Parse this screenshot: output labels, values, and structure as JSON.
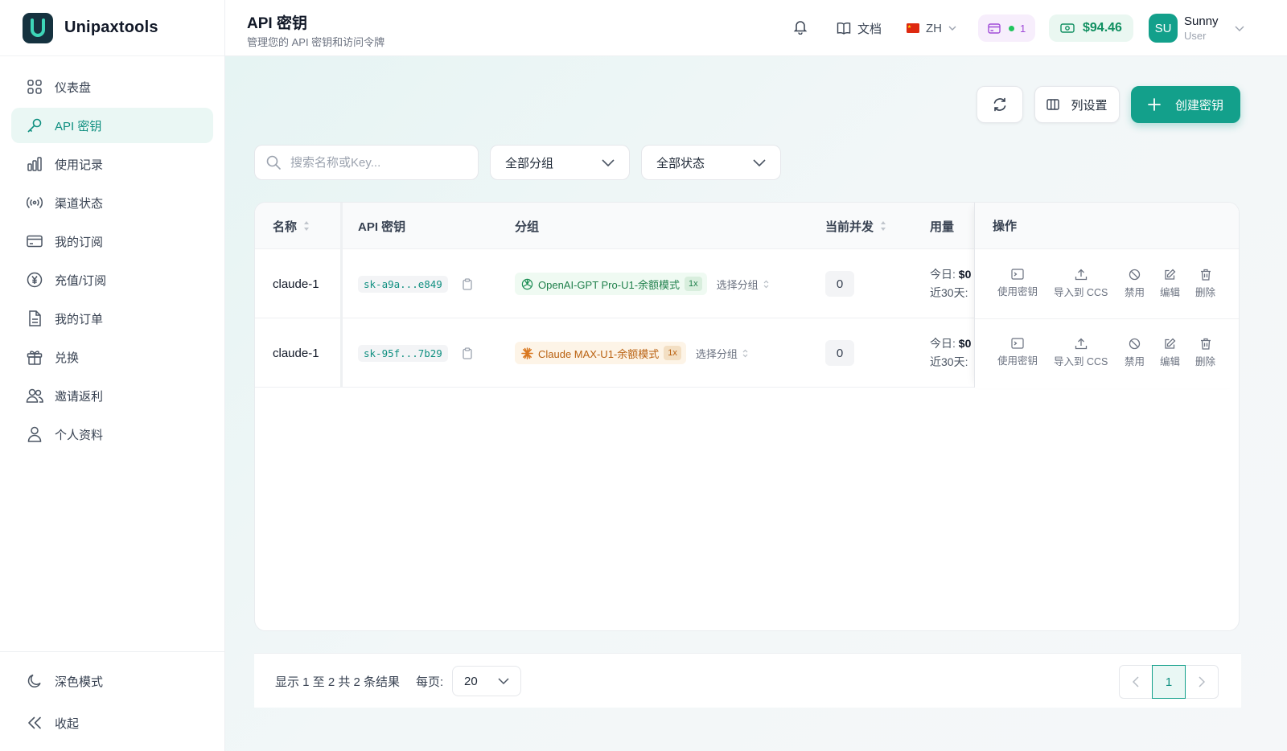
{
  "brand": {
    "name": "Unipaxtools",
    "logo_letter": "U"
  },
  "sidebar": {
    "items": [
      {
        "label": "仪表盘",
        "icon": "grid-icon",
        "active": false
      },
      {
        "label": "API 密钥",
        "icon": "key-icon",
        "active": true
      },
      {
        "label": "使用记录",
        "icon": "bar-chart-icon",
        "active": false
      },
      {
        "label": "渠道状态",
        "icon": "broadcast-icon",
        "active": false
      },
      {
        "label": "我的订阅",
        "icon": "credit-card-icon",
        "active": false
      },
      {
        "label": "充值/订阅",
        "icon": "yen-circle-icon",
        "active": false
      },
      {
        "label": "我的订单",
        "icon": "document-icon",
        "active": false
      },
      {
        "label": "兑换",
        "icon": "gift-icon",
        "active": false
      },
      {
        "label": "邀请返利",
        "icon": "users-icon",
        "active": false
      },
      {
        "label": "个人资料",
        "icon": "user-icon",
        "active": false
      }
    ],
    "dark_mode_label": "深色模式",
    "collapse_label": "收起"
  },
  "header": {
    "title": "API 密钥",
    "subtitle": "管理您的 API 密钥和访问令牌",
    "docs_label": "文档",
    "lang_label": "ZH",
    "subscription_count": "1",
    "balance": "$94.46",
    "user": {
      "initials": "SU",
      "name": "Sunny",
      "role": "User"
    }
  },
  "toolbar": {
    "columns_label": "列设置",
    "create_label": "创建密钥"
  },
  "filters": {
    "search_placeholder": "搜索名称或Key...",
    "group_value": "全部分组",
    "status_value": "全部状态"
  },
  "table": {
    "columns": {
      "name": "名称",
      "key": "API 密钥",
      "group": "分组",
      "concurrency": "当前并发",
      "usage": "用量",
      "actions": "操作"
    },
    "rows": [
      {
        "name": "claude-1",
        "key": "sk-a9a...e849",
        "group": "OpenAI-GPT Pro-U1-余额模式",
        "group_icon": "openai-icon",
        "multiplier": "1x",
        "select_group": "选择分组",
        "concurrency": "0",
        "usage_today_label": "今日:",
        "usage_today_value": "$0",
        "usage_30d_label": "近30天:"
      },
      {
        "name": "claude-1",
        "key": "sk-95f...7b29",
        "group": "Claude MAX-U1-余额模式",
        "group_icon": "claude-sunburst-icon",
        "multiplier": "1x",
        "select_group": "选择分组",
        "concurrency": "0",
        "usage_today_label": "今日:",
        "usage_today_value": "$0",
        "usage_30d_label": "近30天:"
      }
    ],
    "actions": {
      "use_key": "使用密钥",
      "import_ccs": "导入到 CCS",
      "disable": "禁用",
      "edit": "编辑",
      "delete": "删除"
    }
  },
  "pagination": {
    "summary": "显示 1 至 2 共 2 条结果",
    "per_page_label": "每页:",
    "per_page_value": "20",
    "current_page": "1"
  },
  "colors": {
    "accent": "#13a08b",
    "brand_dark": "#15323f",
    "openai_green": "#1e8f56",
    "claude_orange": "#c86a12"
  }
}
